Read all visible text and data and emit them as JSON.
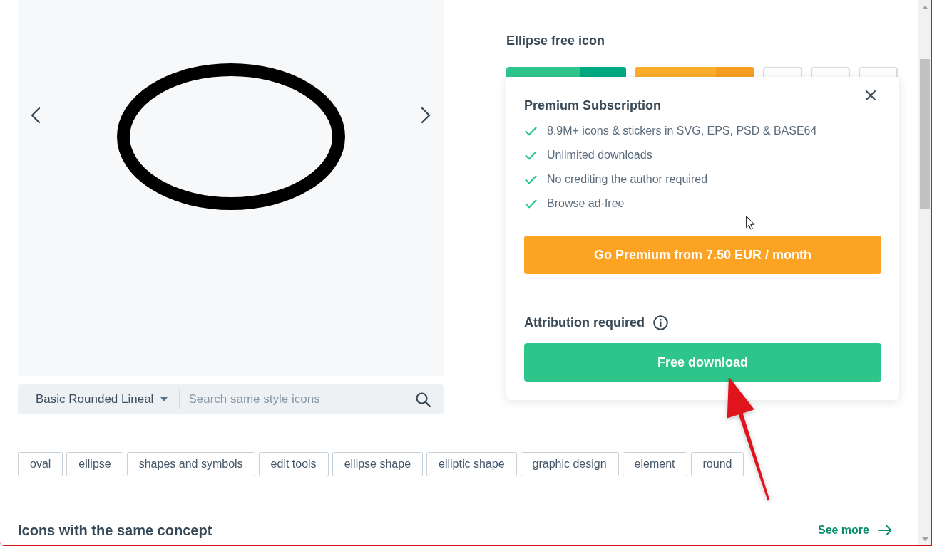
{
  "style_search": {
    "style": "Basic Rounded Lineal",
    "placeholder": "Search same style icons"
  },
  "title": "Ellipse free icon",
  "action_buttons": [
    {
      "kind": "primary"
    },
    {
      "kind": "accent"
    },
    {
      "kind": "outline"
    },
    {
      "kind": "outline"
    },
    {
      "kind": "outline"
    }
  ],
  "popup": {
    "title": "Premium Subscription",
    "features": [
      "8.9M+ icons & stickers in SVG, EPS, PSD & BASE64",
      "Unlimited downloads",
      "No crediting the author required",
      "Browse ad-free"
    ],
    "premium_button": "Go Premium from 7.50 EUR / month",
    "attribution_label": "Attribution required",
    "download_button": "Free download"
  },
  "tags": [
    "oval",
    "ellipse",
    "shapes and symbols",
    "edit tools",
    "ellipse shape",
    "elliptic shape",
    "graphic design",
    "element",
    "round"
  ],
  "related": {
    "heading": "Icons with the same concept",
    "link": "See more"
  }
}
